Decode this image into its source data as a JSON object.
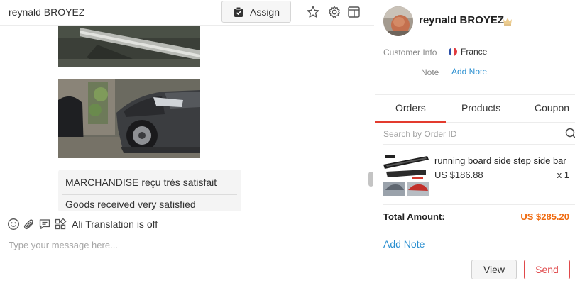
{
  "chat": {
    "title": "reynald BROYEZ",
    "assign_label": "Assign",
    "header_icons": [
      "clipboard-icon",
      "star-icon",
      "gear-icon",
      "side-panel-icon"
    ],
    "messages": {
      "original": "MARCHANDISE reçu  très  satisfait",
      "translated": "Goods received very satisfied"
    },
    "composer": {
      "translation_status": "Ali Translation is off",
      "placeholder": "Type your message here...",
      "toolbar_icons": [
        "emoji-icon",
        "attachment-icon",
        "quick-reply-icon",
        "products-icon"
      ]
    }
  },
  "customer": {
    "name": "reynald BROYEZ",
    "info_label": "Customer Info",
    "country": "France",
    "note_label": "Note",
    "add_note_link": "Add Note"
  },
  "tabs": [
    {
      "label": "Orders",
      "active": true
    },
    {
      "label": "Products",
      "active": false
    },
    {
      "label": "Coupon",
      "active": false
    }
  ],
  "orders": {
    "search_placeholder": "Search by Order ID",
    "items": [
      {
        "title": "running board side step side bar",
        "price": "US $186.88",
        "quantity": "x 1"
      }
    ],
    "total_label": "Total Amount:",
    "total_value": "US $285.20",
    "add_note_label": "Add Note",
    "view_label": "View",
    "send_label": "Send"
  },
  "colors": {
    "accent_red": "#e33b2e",
    "link_blue": "#2a8fd0",
    "total_orange": "#f06a0f"
  }
}
